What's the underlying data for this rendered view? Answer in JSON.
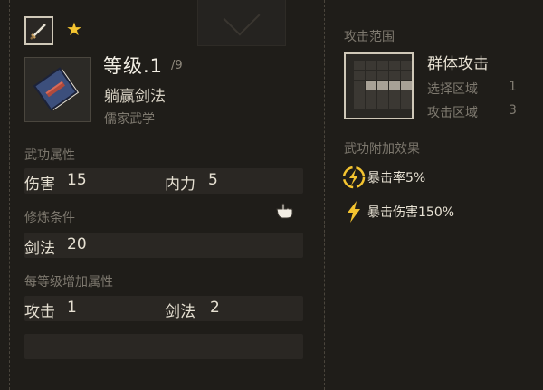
{
  "skill": {
    "level_label": "等级.1",
    "level_max": "/9",
    "name": "躺赢剑法",
    "school": "儒家武学"
  },
  "sections": {
    "attributes_title": "武功属性",
    "requirement_title": "修炼条件",
    "per_level_title": "每等级增加属性",
    "range_title": "攻击范围",
    "effects_title": "武功附加效果"
  },
  "attributes": [
    {
      "label": "伤害",
      "value": "15"
    },
    {
      "label": "内力",
      "value": "5"
    }
  ],
  "requirement": {
    "label": "剑法",
    "value": "20"
  },
  "per_level": [
    {
      "label": "攻击",
      "value": "1"
    },
    {
      "label": "剑法",
      "value": "2"
    }
  ],
  "range": {
    "type": "群体攻击",
    "select_label": "选择区域",
    "select_value": "1",
    "attack_label": "攻击区域",
    "attack_value": "3",
    "grid": [
      [
        0,
        0,
        0,
        0,
        0
      ],
      [
        0,
        0,
        0,
        0,
        0
      ],
      [
        0,
        1,
        1,
        1,
        1
      ],
      [
        0,
        0,
        0,
        0,
        0
      ],
      [
        0,
        0,
        0,
        0,
        0
      ]
    ]
  },
  "effects": [
    {
      "icon": "lightning-circle-icon",
      "text": "暴击率5%"
    },
    {
      "icon": "lightning-icon",
      "text": "暴击伤害150%"
    }
  ],
  "icons": {
    "weapon": "sword-icon",
    "favorite": "star-icon",
    "cursor": "hand-cursor-icon"
  },
  "colors": {
    "accent": "#f4c430",
    "bar": "#2a2723",
    "panel": "#1f1d19"
  }
}
